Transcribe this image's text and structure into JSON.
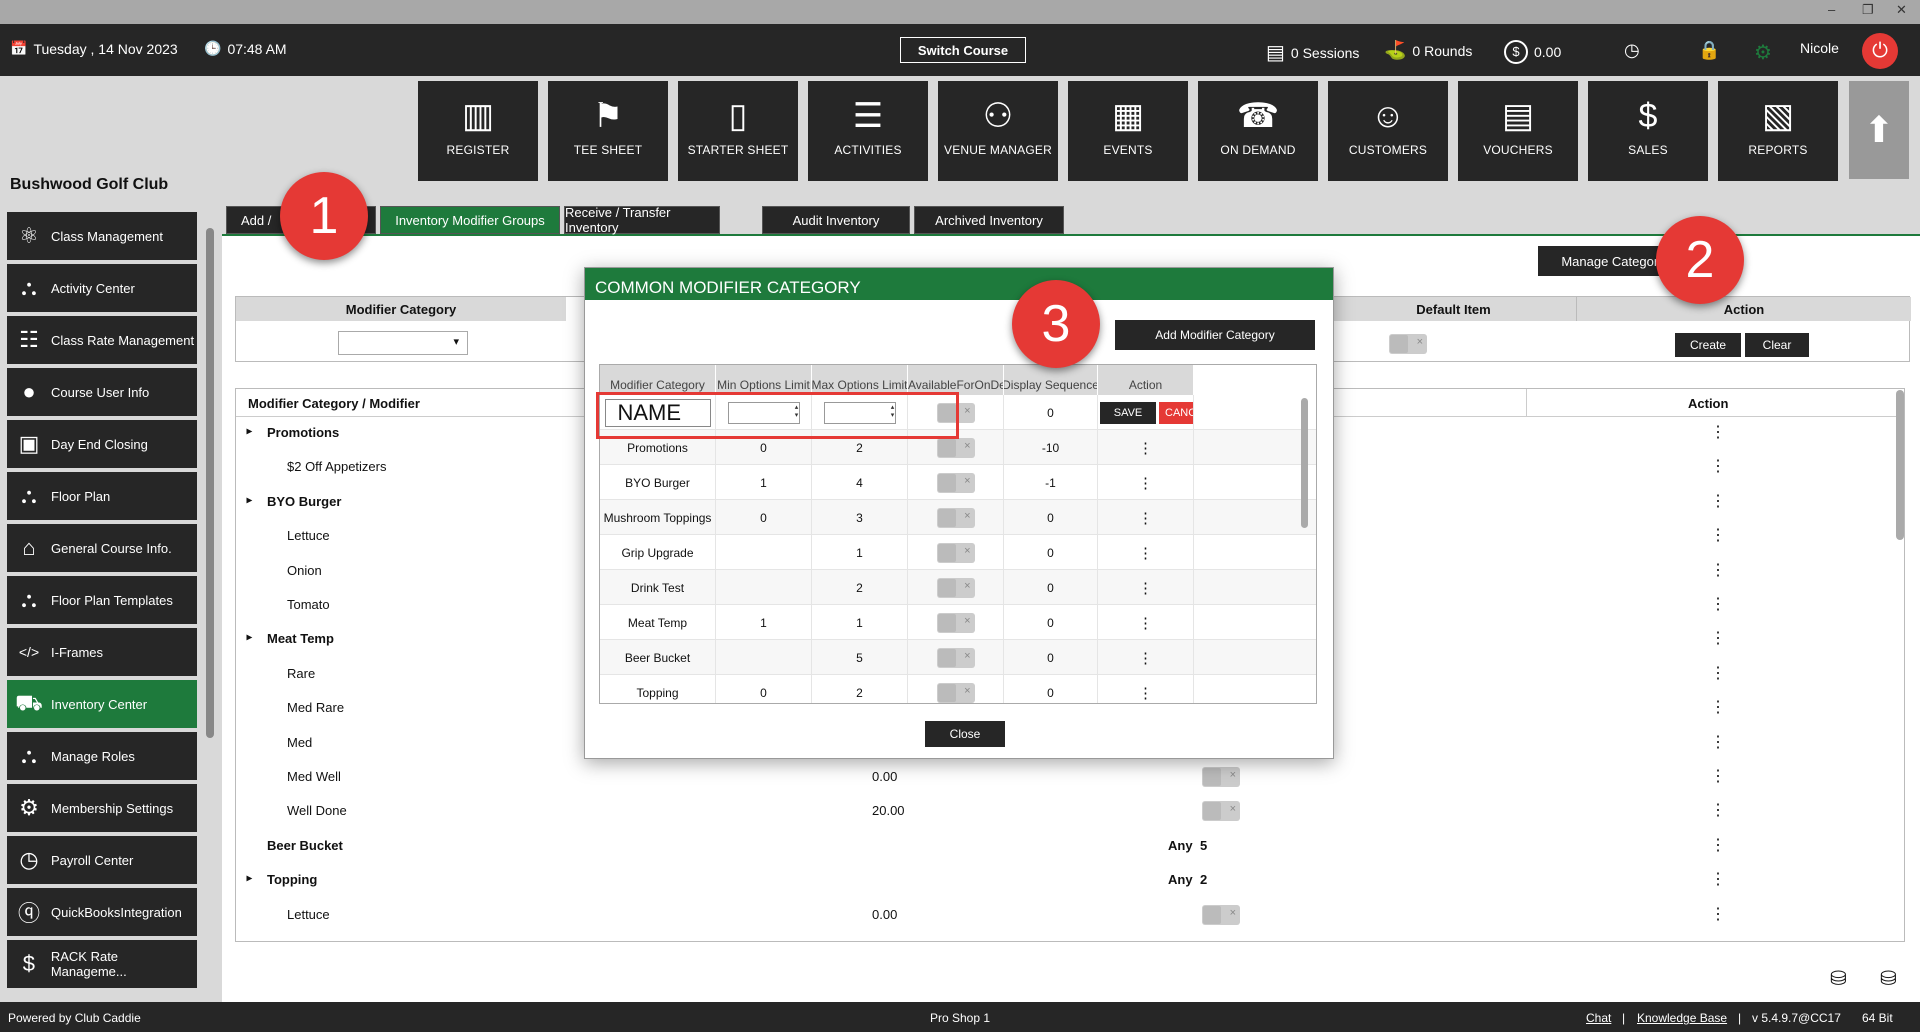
{
  "window": {
    "minimize": "–",
    "restore": "❐",
    "close": "✕"
  },
  "topbar": {
    "date": "Tuesday ,  14 Nov 2023",
    "time": "07:48 AM",
    "switch_course": "Switch Course",
    "sessions": "0 Sessions",
    "rounds": "0 Rounds",
    "balance": "0.00",
    "user": "Nicole"
  },
  "nav": [
    "REGISTER",
    "TEE SHEET",
    "STARTER SHEET",
    "ACTIVITIES",
    "VENUE MANAGER",
    "EVENTS",
    "ON DEMAND",
    "CUSTOMERS",
    "VOUCHERS",
    "SALES",
    "REPORTS"
  ],
  "club_name": "Bushwood Golf Club",
  "sidebar": [
    "Class Management",
    "Activity  Center",
    "Class Rate Management",
    "Course User Info",
    "Day End Closing",
    "Floor Plan",
    "General Course Info.",
    "Floor Plan Templates",
    "I-Frames",
    "Inventory Center",
    "Manage Roles",
    "Membership Settings",
    "Payroll Center",
    "QuickBooksIntegration",
    "RACK Rate Manageme..."
  ],
  "tabs": [
    "Add / ",
    "Inventory Modifier Groups",
    "Receive / Transfer Inventory",
    "Audit Inventory",
    "Archived Inventory"
  ],
  "badges": {
    "b1": "1",
    "b2": "2",
    "b3": "3"
  },
  "manage_category": "Manage Category",
  "filter": {
    "modifier_category": "Modifier Category",
    "default_item": "Default Item",
    "action": "Action",
    "create": "Create",
    "clear": "Clear"
  },
  "tree": {
    "header_col1": "Modifier Category / Modifier",
    "header_action": "Action",
    "rows": [
      {
        "t": "Promotions",
        "group": true
      },
      {
        "t": "$2 Off Appetizers",
        "group": false
      },
      {
        "t": "BYO Burger",
        "group": true
      },
      {
        "t": "Lettuce",
        "group": false
      },
      {
        "t": "Onion",
        "group": false
      },
      {
        "t": "Tomato",
        "group": false
      },
      {
        "t": "Meat Temp",
        "group": true
      },
      {
        "t": "Rare",
        "group": false
      },
      {
        "t": "Med Rare",
        "group": false
      },
      {
        "t": "Med",
        "group": false
      },
      {
        "t": "Med Well",
        "group": false,
        "price": "0.00",
        "toggle": true
      },
      {
        "t": "Well Done",
        "group": false,
        "price": "20.00",
        "toggle": true
      },
      {
        "t": "Beer Bucket",
        "group": true,
        "nochev": true,
        "any": "Any",
        "anyn": "5"
      },
      {
        "t": "Topping",
        "group": true,
        "any": "Any",
        "anyn": "2"
      },
      {
        "t": "Lettuce",
        "group": false,
        "price": "0.00",
        "toggle": true
      }
    ]
  },
  "modal": {
    "title": "COMMON MODIFIER CATEGORY",
    "add_button": "Add Modifier Category",
    "headers": [
      "Modifier Category",
      "Min Options Limit",
      "Max Options Limit",
      "AvailableForOnDemand",
      "Display Sequence",
      "Action"
    ],
    "new_row": {
      "name": "NAME",
      "display_sequence": "0",
      "save": "SAVE",
      "cancel": "CANCEL"
    },
    "rows": [
      {
        "name": "Promotions",
        "min": "0",
        "max": "2",
        "seq": "-10"
      },
      {
        "name": "BYO Burger",
        "min": "1",
        "max": "4",
        "seq": "-1"
      },
      {
        "name": "Mushroom Toppings",
        "min": "0",
        "max": "3",
        "seq": "0"
      },
      {
        "name": "Grip Upgrade",
        "min": "",
        "max": "1",
        "seq": "0"
      },
      {
        "name": "Drink Test",
        "min": "",
        "max": "2",
        "seq": "0"
      },
      {
        "name": "Meat Temp",
        "min": "1",
        "max": "1",
        "seq": "0"
      },
      {
        "name": "Beer Bucket",
        "min": "",
        "max": "5",
        "seq": "0"
      },
      {
        "name": "Topping",
        "min": "0",
        "max": "2",
        "seq": "0"
      }
    ],
    "close": "Close"
  },
  "footer": {
    "powered": "Powered by Club Caddie",
    "center": "Pro Shop 1",
    "chat": "Chat",
    "sep": "|",
    "kb": "Knowledge Base",
    "version": "v 5.4.9.7@CC17",
    "bits": "64 Bit"
  },
  "colors": {
    "green": "#1e7a3c",
    "dark": "#262626",
    "red": "#e53935",
    "gray": "#d9d9d9"
  }
}
